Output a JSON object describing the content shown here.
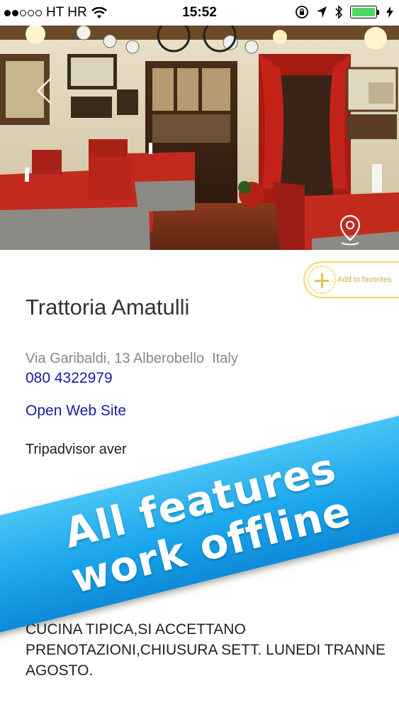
{
  "status_bar": {
    "carrier": "HT HR",
    "time": "15:52",
    "signal_filled": 2,
    "signal_total": 5,
    "battery_level": 1.0
  },
  "hero": {
    "back_icon": "chevron-left-icon",
    "map_icon": "map-pin-icon"
  },
  "favorites": {
    "label": "Add to favorites",
    "icon": "plus-icon",
    "color": "#e8c54a"
  },
  "restaurant": {
    "name": "Trattoria Amatulli",
    "address": "Via Garibaldi, 13 Alberobello  Italy",
    "phone": "080 4322979",
    "website_label": "Open Web Site",
    "tripadvisor_text": "Tripadvisor aver",
    "description": "CUCINA TIPICA,SI ACCETTANO PRENOTAZIONI,CHIUSURA SETT. LUNEDI TRANNE AGOSTO."
  },
  "banner": {
    "line1": "All features",
    "line2": "work offline",
    "color": "#1ba6ec"
  },
  "colors": {
    "link": "#1a1aa8",
    "address": "#888888",
    "title": "#333333"
  }
}
